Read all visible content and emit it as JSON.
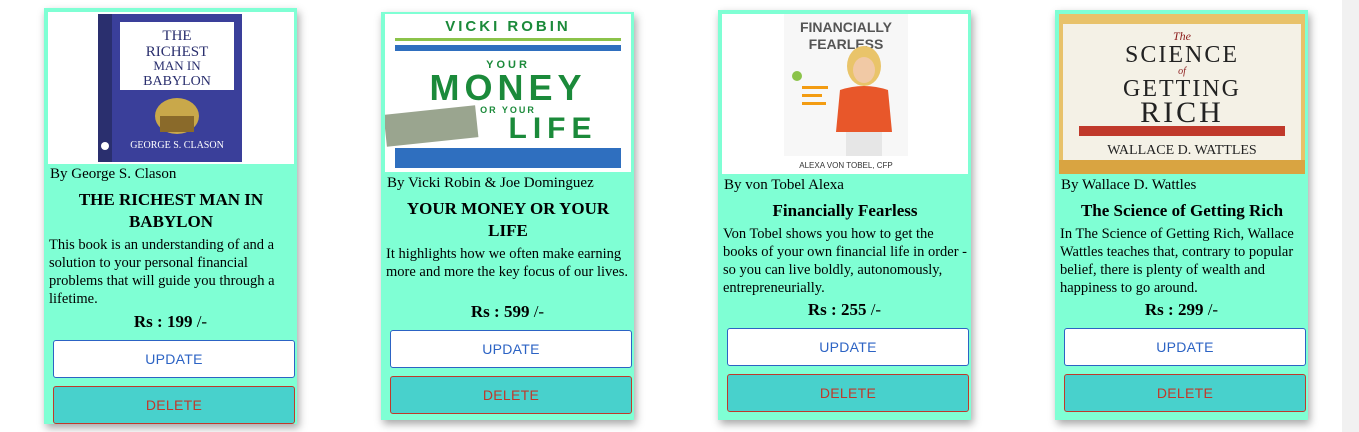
{
  "currency_label": "Rs :",
  "price_suffix": "/-",
  "update_label": "UPDATE",
  "delete_label": "DELETE",
  "colors": {
    "card_bg": "#7fffd4",
    "delete_bg": "#48d1cc",
    "update_border": "#2c63c4",
    "delete_border": "#c0392b"
  },
  "books": [
    {
      "cover_title_lines": [
        "THE",
        "RICHEST",
        "MAN IN",
        "BABYLON"
      ],
      "cover_author": "GEORGE S. CLASON",
      "author": "By George S. Clason",
      "title": "THE RICHEST MAN IN BABYLON",
      "description": "This book is an understanding of and a solution to your personal financial problems that will guide you through a lifetime.",
      "price": "199"
    },
    {
      "cover_author": "VICKI ROBIN",
      "cover_title_lines": [
        "YOUR",
        "MONEY",
        "OR YOUR",
        "LIFE"
      ],
      "author": "By Vicki Robin & Joe Dominguez",
      "title": "YOUR MONEY OR YOUR LIFE",
      "description": "It highlights how we often make earning more and more the key focus of our lives.",
      "price": "599"
    },
    {
      "cover_title_lines": [
        "FINANCIALLY",
        "FEARLESS"
      ],
      "cover_author": "ALEXA VON TOBEL, CFP",
      "author": "By von Tobel Alexa",
      "title": "Financially Fearless",
      "description": "Von Tobel shows you how to get the books of your own financial life in order - so you can live boldly, autonomously, entrepreneurially.",
      "price": "255"
    },
    {
      "cover_title_lines": [
        "The",
        "SCIENCE",
        "of",
        "GETTING",
        "RICH"
      ],
      "cover_author": "WALLACE D. WATTLES",
      "author": "By Wallace D. Wattles",
      "title": "The Science of Getting Rich",
      "description": "In The Science of Getting Rich, Wallace Wattles teaches that, contrary to popular belief, there is plenty of wealth and happiness to go around.",
      "price": "299"
    }
  ]
}
